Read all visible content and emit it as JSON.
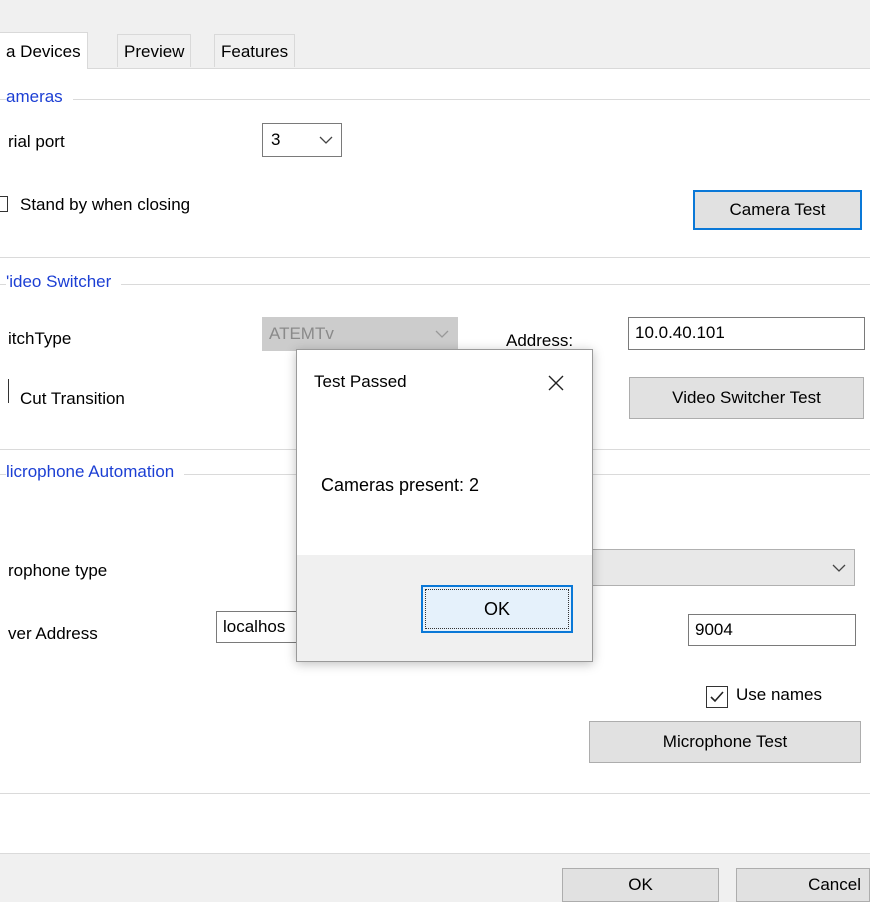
{
  "tabs": [
    {
      "label": "a Devices",
      "active": true
    },
    {
      "label": "Preview",
      "active": false
    },
    {
      "label": "Features",
      "active": false
    }
  ],
  "cameras": {
    "group_title": "ameras",
    "serial_port_label": "rial port",
    "serial_port_value": "3",
    "standby_label": "Stand by when closing",
    "standby_checked": false,
    "test_button": "Camera Test"
  },
  "video_switcher": {
    "group_title": "'ideo Switcher",
    "switch_type_label": "itchType",
    "switch_type_value": "ATEMTv",
    "address_label": "Address:",
    "address_value": "10.0.40.101",
    "cut_transition_label": "Cut Transition",
    "cut_transition_checked": false,
    "test_button": "Video Switcher Test"
  },
  "microphone": {
    "group_title": "licrophone Automation",
    "type_label": "rophone type",
    "type_value": "",
    "server_address_label": "ver Address",
    "server_address_value": "localhos",
    "port_value": "9004",
    "use_names_label": "Use names",
    "use_names_checked": true,
    "test_button": "Microphone Test"
  },
  "footer": {
    "ok_button": "OK",
    "cancel_button": "Cancel"
  },
  "dialog": {
    "title": "Test Passed",
    "message": "Cameras present: 2",
    "ok_button": "OK"
  },
  "colors": {
    "group_title": "#1c3fd4",
    "focus_border": "#0a78d7"
  }
}
